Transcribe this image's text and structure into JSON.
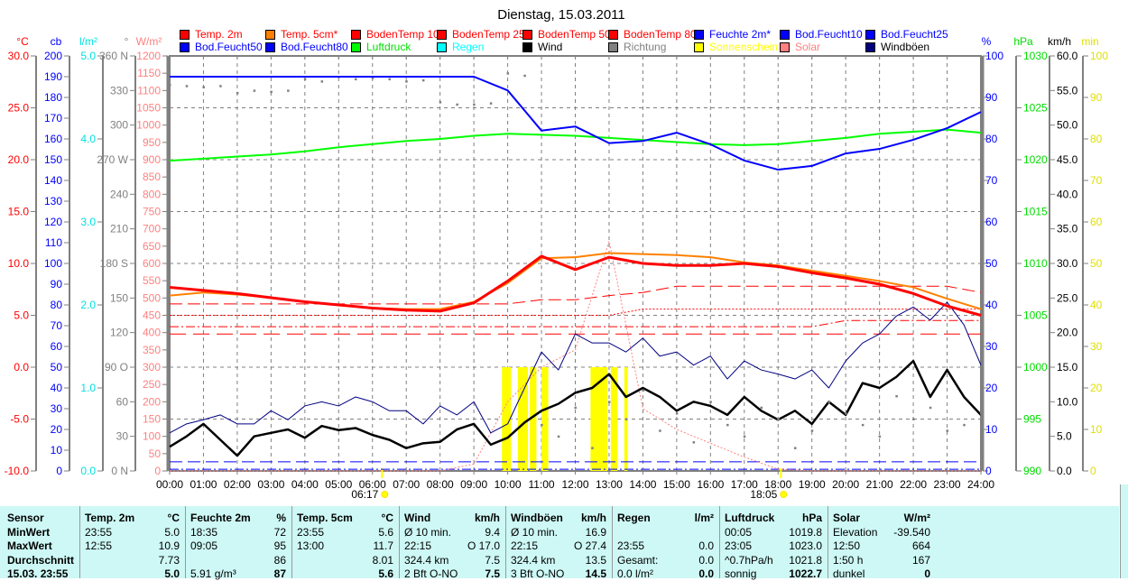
{
  "title": "Dienstag, 15.03.2011",
  "legend": [
    {
      "label": "Temp. 2m",
      "color": "#ff0000",
      "text": "#ff0000"
    },
    {
      "label": "Temp. 5cm*",
      "color": "#ff8000",
      "text": "#ff0000"
    },
    {
      "label": "BodenTemp 10",
      "color": "#ff0000",
      "text": "#ff0000"
    },
    {
      "label": "BodenTemp 25",
      "color": "#ff0000",
      "text": "#ff0000"
    },
    {
      "label": "BodenTemp 50",
      "color": "#ff0000",
      "text": "#ff0000"
    },
    {
      "label": "BodenTemp 80",
      "color": "#ff0000",
      "text": "#ff0000"
    },
    {
      "label": "Feuchte 2m*",
      "color": "#0000ff",
      "text": "#0000ff"
    },
    {
      "label": "Bod.Feucht10",
      "color": "#0000ff",
      "text": "#0000ff"
    },
    {
      "label": "Bod.Feucht25",
      "color": "#0000ff",
      "text": "#0000ff"
    },
    {
      "label": "Bod.Feucht50",
      "color": "#0000ff",
      "text": "#0000ff"
    },
    {
      "label": "Bod.Feucht80",
      "color": "#0000ff",
      "text": "#0000ff"
    },
    {
      "label": "Luftdruck",
      "color": "#00ff00",
      "text": "#00dd00"
    },
    {
      "label": "Regen",
      "color": "#00ffff",
      "text": "#00ffff"
    },
    {
      "label": "Wind",
      "color": "#000000",
      "text": "#000000"
    },
    {
      "label": "Richtung",
      "color": "#808080",
      "text": "#808080"
    },
    {
      "label": "Sonnenschein",
      "color": "#ffff00",
      "text": "#ffff00"
    },
    {
      "label": "Solar",
      "color": "#ff8080",
      "text": "#ff8080"
    },
    {
      "label": "Windböen",
      "color": "#000080",
      "text": "#000000"
    }
  ],
  "chart_data": {
    "type": "line",
    "title": "Dienstag, 15.03.2011",
    "x_ticks": [
      "00:00",
      "01:00",
      "02:00",
      "03:00",
      "04:00",
      "05:00",
      "06:00",
      "07:00",
      "08:00",
      "09:00",
      "10:00",
      "11:00",
      "12:00",
      "13:00",
      "14:00",
      "15:00",
      "16:00",
      "17:00",
      "18:00",
      "19:00",
      "20:00",
      "21:00",
      "22:00",
      "23:00",
      "24:00"
    ],
    "xlim_hours": [
      0,
      24
    ],
    "grid": true,
    "sunrise": {
      "label": "06:17",
      "hour": 6.283
    },
    "sunset": {
      "label": "18:05",
      "hour": 18.083
    },
    "axes": {
      "temp": {
        "unit": "°C",
        "color": "#ff0000",
        "min": -10,
        "max": 30,
        "ticks": [
          "30.0",
          "25.0",
          "20.0",
          "15.0",
          "10.0",
          "5.0",
          "0.0",
          "-5.0",
          "-10.0"
        ]
      },
      "cb": {
        "unit": "cb",
        "color": "#0000ff",
        "min": 0,
        "max": 200,
        "ticks": [
          "200",
          "190",
          "180",
          "170",
          "160",
          "150",
          "140",
          "130",
          "120",
          "110",
          "100",
          "90",
          "80",
          "70",
          "60",
          "50",
          "40",
          "30",
          "20",
          "10",
          "0"
        ]
      },
      "rain": {
        "unit": "l/m²",
        "color": "#00e0e0",
        "min": 0,
        "max": 5,
        "ticks": [
          "5.0",
          "4.0",
          "3.0",
          "2.0",
          "1.0",
          "0.0"
        ]
      },
      "dir": {
        "unit": "°",
        "color": "#808080",
        "min": 0,
        "max": 360,
        "ticks": [
          "360 N",
          "330",
          "300",
          "270 W",
          "240",
          "210",
          "180 S",
          "150",
          "120",
          "90 O",
          "60",
          "30",
          "0 N"
        ]
      },
      "solar": {
        "unit": "W/m²",
        "color": "#ff8080",
        "min": 0,
        "max": 1200,
        "ticks": [
          "1200",
          "1150",
          "1100",
          "1050",
          "1000",
          "950",
          "900",
          "850",
          "800",
          "750",
          "700",
          "650",
          "600",
          "550",
          "500",
          "450",
          "400",
          "350",
          "300",
          "250",
          "200",
          "150",
          "100",
          "50",
          "0"
        ]
      },
      "hum": {
        "unit": "%",
        "color": "#0000ff",
        "min": 0,
        "max": 100,
        "ticks": [
          "100",
          "90",
          "80",
          "70",
          "60",
          "50",
          "40",
          "30",
          "20",
          "10",
          "0"
        ]
      },
      "press": {
        "unit": "hPa",
        "color": "#00dd00",
        "min": 990,
        "max": 1030,
        "ticks": [
          "1030",
          "1025",
          "1020",
          "1015",
          "1010",
          "1005",
          "1000",
          "995",
          "990"
        ]
      },
      "wind": {
        "unit": "km/h",
        "color": "#000000",
        "min": 0,
        "max": 60,
        "ticks": [
          "60.0",
          "55.0",
          "50.0",
          "45.0",
          "40.0",
          "35.0",
          "30.0",
          "25.0",
          "20.0",
          "15.0",
          "10.0",
          "5.0",
          "0.0"
        ]
      },
      "sun": {
        "unit": "min",
        "color": "#e0e000",
        "min": 0,
        "max": 100,
        "ticks": [
          "100",
          "90",
          "80",
          "70",
          "60",
          "50",
          "40",
          "30",
          "20",
          "10",
          "0"
        ]
      }
    },
    "series": [
      {
        "name": "Bod.Feucht10",
        "axis": "hum",
        "color": "#0000ff",
        "step_h": 24,
        "values": [
          2.2,
          2.2
        ],
        "style": "dash"
      },
      {
        "name": "Bod.Feucht25",
        "axis": "hum",
        "color": "#0000ff",
        "step_h": 24,
        "values": [
          0.4,
          0.4
        ],
        "style": "dashdot"
      },
      {
        "name": "BodenTemp 10",
        "axis": "temp",
        "color": "#ff0000",
        "step_h": 1,
        "style": "dash",
        "values": [
          6.1,
          6.1,
          6.1,
          6.1,
          6.1,
          6.1,
          6.1,
          6.1,
          6.1,
          6.1,
          6.1,
          6.5,
          6.5,
          6.9,
          7.2,
          7.8,
          7.8,
          7.8,
          7.8,
          7.8,
          7.8,
          7.8,
          7.8,
          7.8,
          7.2
        ]
      },
      {
        "name": "BodenTemp 25",
        "axis": "temp",
        "color": "#ff0000",
        "step_h": 1,
        "style": "dot",
        "values": [
          5.0,
          5.0,
          5.0,
          5.0,
          5.0,
          5.0,
          5.0,
          5.0,
          5.0,
          5.0,
          5.0,
          5.0,
          5.0,
          5.0,
          5.6,
          5.6,
          5.6,
          5.6,
          5.6,
          5.6,
          5.6,
          5.6,
          5.6,
          5.6,
          5.6
        ]
      },
      {
        "name": "BodenTemp 50",
        "axis": "temp",
        "color": "#ff0000",
        "step_h": 1,
        "style": "dashdot",
        "values": [
          3.9,
          3.9,
          3.9,
          3.9,
          3.9,
          3.9,
          3.9,
          3.9,
          3.9,
          3.9,
          3.9,
          3.9,
          3.9,
          3.9,
          3.9,
          3.9,
          3.9,
          3.9,
          3.9,
          3.9,
          4.5,
          4.5,
          4.5,
          4.5,
          4.5
        ]
      },
      {
        "name": "BodenTemp 80",
        "axis": "temp",
        "color": "#ff0000",
        "step_h": 1,
        "style": "dash2",
        "values": [
          3.2,
          3.2,
          3.2,
          3.2,
          3.2,
          3.2,
          3.2,
          3.2,
          3.2,
          3.2,
          3.2,
          3.2,
          3.2,
          3.2,
          3.2,
          3.2,
          3.2,
          3.2,
          3.2,
          3.2,
          3.2,
          3.2,
          3.2,
          3.2,
          3.2
        ]
      },
      {
        "name": "Solar",
        "axis": "solar",
        "color": "#ff8080",
        "step_h": 1,
        "style": "dot",
        "values": [
          0,
          0,
          0,
          0,
          0,
          0,
          0,
          0,
          0,
          20,
          200,
          300,
          350,
          664,
          180,
          120,
          80,
          40,
          5,
          0,
          0,
          0,
          0,
          0,
          0
        ]
      },
      {
        "name": "Windböen",
        "axis": "wind",
        "color": "#000080",
        "step_h": 0.5,
        "width": 1,
        "values": [
          5.5,
          6.8,
          7.4,
          8.1,
          6.8,
          6.8,
          8.7,
          7.4,
          9.4,
          10.0,
          9.4,
          10.7,
          10.0,
          8.7,
          8.7,
          6.8,
          9.4,
          8.1,
          10.0,
          5.5,
          6.8,
          12.0,
          17.2,
          14.6,
          19.8,
          18.5,
          18.5,
          17.2,
          19.2,
          16.6,
          17.2,
          15.3,
          16.6,
          13.3,
          15.9,
          14.6,
          14.0,
          13.3,
          14.6,
          12.0,
          15.9,
          18.5,
          19.8,
          22.4,
          23.7,
          21.8,
          24.4,
          21.1,
          15.3
        ]
      },
      {
        "name": "Wind",
        "axis": "wind",
        "color": "#000000",
        "step_h": 0.5,
        "width": 2.5,
        "values": [
          3.5,
          5.0,
          6.8,
          4.5,
          2.2,
          5.0,
          5.5,
          6.0,
          4.8,
          6.5,
          5.9,
          6.2,
          5.2,
          4.5,
          3.3,
          4.0,
          4.2,
          6.0,
          6.8,
          3.8,
          4.8,
          7.0,
          8.7,
          9.7,
          11.3,
          12.0,
          14.0,
          10.7,
          12.0,
          10.7,
          8.7,
          10.0,
          9.4,
          8.1,
          10.7,
          8.7,
          7.4,
          8.7,
          6.8,
          10.0,
          8.1,
          12.7,
          12.0,
          13.6,
          15.9,
          10.7,
          14.6,
          10.7,
          8.1
        ]
      },
      {
        "name": "Richtung",
        "axis": "dir",
        "color": "#808080",
        "step_h": 0.5,
        "style": "points",
        "values": [
          335,
          334,
          333,
          334,
          328,
          330,
          329,
          330,
          340,
          338,
          342,
          340,
          341,
          340,
          338,
          339,
          320,
          318,
          318,
          319,
          345,
          343,
          40,
          30,
          55,
          20,
          60,
          45,
          70,
          35,
          50,
          25,
          60,
          40,
          30,
          55,
          45,
          20,
          35,
          60,
          50,
          40,
          30,
          65,
          45,
          55,
          35,
          40,
          50
        ]
      },
      {
        "name": "Luftdruck",
        "axis": "press",
        "color": "#00ff00",
        "step_h": 1,
        "width": 2,
        "values": [
          1019.9,
          1020.1,
          1020.3,
          1020.5,
          1020.8,
          1021.2,
          1021.5,
          1021.8,
          1022.0,
          1022.3,
          1022.5,
          1022.4,
          1022.3,
          1022.1,
          1021.9,
          1021.7,
          1021.5,
          1021.4,
          1021.5,
          1021.8,
          1022.1,
          1022.5,
          1022.7,
          1022.9,
          1022.6
        ]
      },
      {
        "name": "Feuchte 2m",
        "axis": "hum",
        "color": "#0000ff",
        "step_h": 1,
        "width": 2,
        "values": [
          95,
          95,
          95,
          95,
          95,
          95,
          95,
          95,
          95,
          95,
          91.7,
          82,
          83,
          79,
          79.5,
          81.5,
          78.7,
          74.8,
          72.6,
          73.5,
          76.5,
          77.6,
          79.8,
          82.6,
          86.5
        ]
      },
      {
        "name": "Temp. 5cm",
        "axis": "temp",
        "color": "#ff8000",
        "step_h": 1,
        "width": 2,
        "values": [
          6.9,
          7.2,
          7.0,
          6.7,
          6.3,
          6.0,
          5.7,
          5.6,
          5.6,
          6.3,
          8.1,
          10.5,
          10.6,
          11.0,
          10.9,
          10.8,
          10.6,
          10.1,
          9.8,
          9.3,
          8.8,
          8.3,
          7.7,
          6.6,
          5.6
        ]
      },
      {
        "name": "Temp. 2m",
        "axis": "temp",
        "color": "#ff0000",
        "step_h": 1,
        "width": 3,
        "values": [
          7.7,
          7.4,
          7.1,
          6.7,
          6.3,
          6.0,
          5.7,
          5.5,
          5.4,
          6.2,
          8.3,
          10.7,
          9.4,
          10.6,
          10.0,
          9.8,
          9.8,
          10.0,
          9.7,
          9.1,
          8.6,
          8.0,
          7.1,
          5.9,
          5.0
        ]
      }
    ],
    "sunshine_minutes": [
      [
        9.83,
        10.1,
        5
      ],
      [
        10.3,
        10.6,
        5
      ],
      [
        10.65,
        10.85,
        5
      ],
      [
        11.0,
        11.2,
        5
      ],
      [
        12.45,
        12.95,
        5
      ],
      [
        13.05,
        13.25,
        5
      ],
      [
        13.45,
        13.55,
        5
      ]
    ]
  },
  "table": {
    "header": {
      "label": "Sensor",
      "cells": [
        [
          "Temp. 2m",
          "°C"
        ],
        [
          "Feuchte 2m",
          "%"
        ],
        [
          "Temp. 5cm",
          "°C"
        ],
        [
          "Wind",
          "km/h"
        ],
        [
          "Windböen",
          "km/h"
        ],
        [
          "Regen",
          "l/m²"
        ],
        [
          "Luftdruck",
          "hPa"
        ],
        [
          "Solar",
          "W/m²"
        ]
      ]
    },
    "rows": [
      {
        "label": "MinWert",
        "cells": [
          [
            "23:55",
            "5.0"
          ],
          [
            "18:35",
            "72"
          ],
          [
            "23:55",
            "5.6"
          ],
          [
            "Ø 10 min.",
            "9.4"
          ],
          [
            "Ø 10 min.",
            "16.9"
          ],
          [
            "",
            ""
          ],
          [
            "00:05",
            "1019.8"
          ],
          [
            "Elevation",
            "-39.540"
          ]
        ]
      },
      {
        "label": "MaxWert",
        "cells": [
          [
            "12:55",
            "10.9"
          ],
          [
            "09:05",
            "95"
          ],
          [
            "13:00",
            "11.7"
          ],
          [
            "22:15",
            "O 17.0"
          ],
          [
            "22:15",
            "O 27.4"
          ],
          [
            "23:55",
            "0.0"
          ],
          [
            "23:05",
            "1023.0"
          ],
          [
            "12:50",
            "664"
          ]
        ]
      },
      {
        "label": "Durchschnitt",
        "cells": [
          [
            "",
            "7.73"
          ],
          [
            "",
            "86"
          ],
          [
            "",
            "8.01"
          ],
          [
            "324.4 km",
            "7.5"
          ],
          [
            "324.4 km",
            "13.5"
          ],
          [
            "Gesamt:",
            "0.0"
          ],
          [
            "^0.7hPa/h",
            "1021.8"
          ],
          [
            "1:50 h",
            "167"
          ]
        ]
      },
      {
        "label": "15.03. 23:55",
        "cells": [
          [
            "",
            "5.0"
          ],
          [
            "5.91 g/m³",
            "87"
          ],
          [
            "",
            "5.6"
          ],
          [
            "2 Bft O-NO",
            "7.5"
          ],
          [
            "3 Bft O-NO",
            "14.5"
          ],
          [
            "0.0 l/m²",
            "0.0"
          ],
          [
            "sonnig",
            "1022.7"
          ],
          [
            "dunkel",
            "0"
          ]
        ]
      }
    ]
  }
}
